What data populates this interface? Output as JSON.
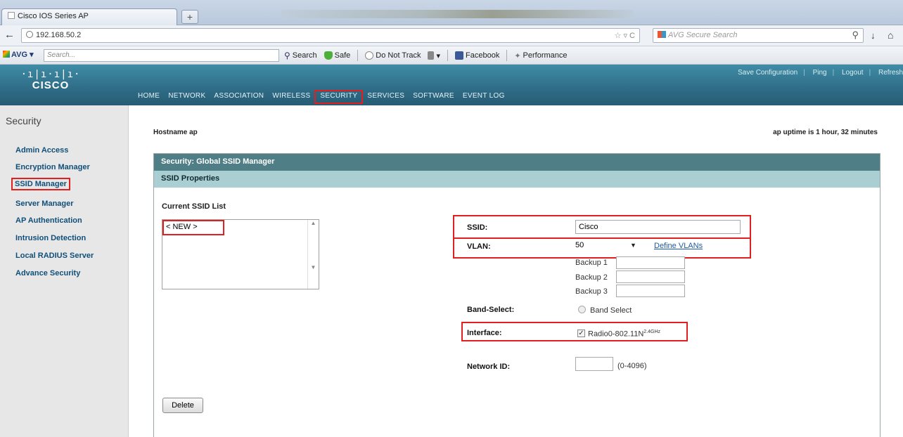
{
  "browser": {
    "tab_title": "Cisco IOS Series AP",
    "new_tab": "+",
    "url": "192.168.50.2",
    "search_placeholder": "AVG Secure Search",
    "avg_label": "AVG",
    "avg_search_placeholder": "Search...",
    "toolbar": {
      "search": "Search",
      "safe": "Safe",
      "do_not_track": "Do Not Track",
      "facebook": "Facebook",
      "performance": "Performance"
    }
  },
  "header": {
    "logo_bars": "·ı|ı·ı|ı·",
    "logo_word": "CISCO",
    "top_links": [
      "Save Configuration",
      "Ping",
      "Logout",
      "Refresh"
    ],
    "nav": [
      "HOME",
      "NETWORK",
      "ASSOCIATION",
      "WIRELESS",
      "SECURITY",
      "SERVICES",
      "SOFTWARE",
      "EVENT LOG"
    ]
  },
  "sidebar": {
    "title": "Security",
    "items": [
      "Admin Access",
      "Encryption Manager",
      "SSID Manager",
      "Server Manager",
      "AP Authentication",
      "Intrusion Detection",
      "Local RADIUS Server",
      "Advance Security"
    ]
  },
  "main": {
    "hostname": "Hostname  ap",
    "uptime": "ap uptime is 1 hour, 32 minutes",
    "panel_title": "Security: Global SSID Manager",
    "panel_sub": "SSID Properties",
    "current_ssid_list_label": "Current SSID List",
    "ssid_list_items": [
      "< NEW >"
    ],
    "delete_label": "Delete",
    "form": {
      "ssid_label": "SSID:",
      "ssid_value": "Cisco",
      "vlan_label": "VLAN:",
      "vlan_value": "50",
      "define_vlans": "Define VLANs",
      "backup1": "Backup 1",
      "backup2": "Backup 2",
      "backup3": "Backup 3",
      "band_select_label": "Band-Select:",
      "band_select_option": "Band Select",
      "interface_label": "Interface:",
      "interface_option": "Radio0-802.11N",
      "interface_sup": "2.4GHz",
      "network_id_label": "Network ID:",
      "network_id_range": "(0-4096)"
    }
  },
  "colors": {
    "highlight": "#e02020",
    "header": "#2f6c86",
    "panel_title": "#507e86",
    "panel_sub": "#a9cfd3"
  }
}
